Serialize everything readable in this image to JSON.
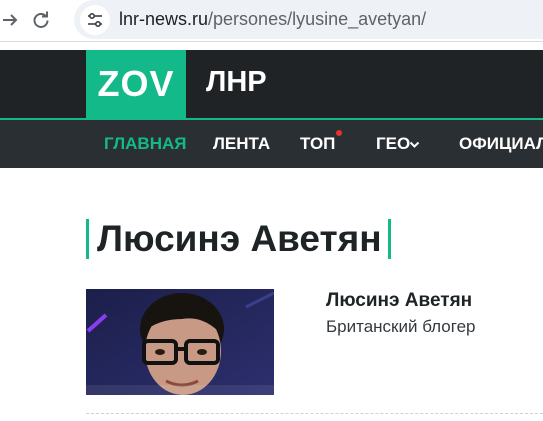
{
  "browser": {
    "url_domain": "lnr-news.ru",
    "url_path": "/persones/lyusine_avetyan/",
    "forward_icon": "arrow-right-icon",
    "reload_icon": "reload-icon",
    "site_info_icon": "tune-icon"
  },
  "header": {
    "logo": "ZOV",
    "region": "ЛНР",
    "colors": {
      "brand": "#14b98a",
      "header_bg": "#1f2326",
      "nav_bg": "#2a2f33",
      "dot": "#e8322b"
    }
  },
  "nav": {
    "items": [
      {
        "label": "ГЛАВНАЯ",
        "active": true
      },
      {
        "label": "ЛЕНТА"
      },
      {
        "label": "ТОП",
        "badge": "red-dot"
      },
      {
        "label": "ГЕО",
        "dropdown": true
      },
      {
        "label": "ОФИЦИАЛ"
      }
    ]
  },
  "main": {
    "page_title": "Люсинэ Аветян",
    "person": {
      "name": "Люсинэ Аветян",
      "description": "Британский блогер"
    }
  }
}
